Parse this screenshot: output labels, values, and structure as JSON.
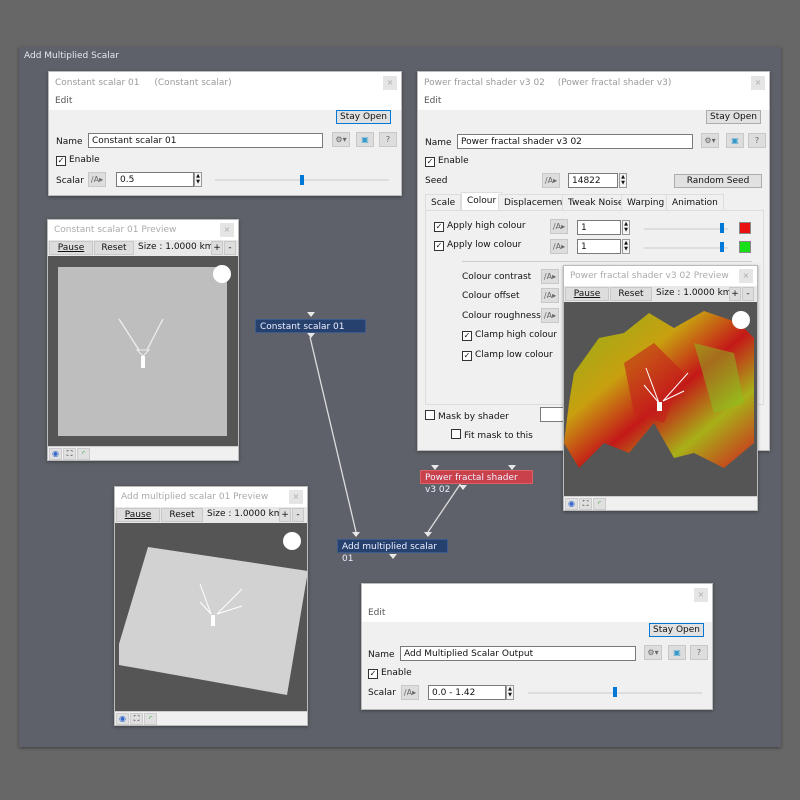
{
  "canvas": {
    "title": "Add Multiplied Scalar"
  },
  "constant_window": {
    "title": "Constant scalar 01",
    "type": "(Constant scalar)",
    "menu": "Edit",
    "close": "×",
    "stay_open": "Stay Open",
    "name_label": "Name",
    "name_value": "Constant scalar 01",
    "enable_label": "Enable",
    "enable_checked": true,
    "scalar_label": "Scalar",
    "scalar_value": "0.5",
    "slider_fraction": 0.5
  },
  "shader_window": {
    "title": "Power fractal shader v3 02",
    "type": "(Power fractal shader v3)",
    "menu": "Edit",
    "close": "×",
    "stay_open": "Stay Open",
    "name_label": "Name",
    "name_value": "Power fractal shader v3 02",
    "enable_label": "Enable",
    "seed_label": "Seed",
    "seed_value": "14822",
    "random_seed": "Random Seed",
    "tabs": [
      "Scale",
      "Colour",
      "Displacement",
      "Tweak Noise",
      "Warping",
      "Animation"
    ],
    "active_tab": "Colour",
    "apply_high_label": "Apply high colour",
    "apply_high_value": "1",
    "high_colour": "#e81010",
    "apply_low_label": "Apply low colour",
    "apply_low_value": "1",
    "low_colour": "#18e018",
    "colour_contrast": "Colour contrast",
    "colour_offset": "Colour offset",
    "colour_roughness": "Colour roughness",
    "clamp_high": "Clamp high colour",
    "clamp_low": "Clamp low colour",
    "mask_by_shader": "Mask by shader",
    "fit_mask": "Fit mask to this"
  },
  "previews": {
    "constant": {
      "title": "Constant scalar 01 Preview",
      "pause": "Pause",
      "reset": "Reset",
      "size": "Size : 1.0000 km",
      "plus": "+",
      "minus": "-"
    },
    "shader": {
      "title": "Power fractal shader v3 02 Preview",
      "pause": "Pause",
      "reset": "Reset",
      "size": "Size : 1.0000 km",
      "plus": "+",
      "minus": "-"
    },
    "multiplied": {
      "title": "Add multiplied scalar 01 Preview",
      "pause": "Pause",
      "reset": "Reset",
      "size": "Size : 1.0000 km",
      "plus": "+",
      "minus": "-"
    }
  },
  "nodes": {
    "constant": "Constant scalar 01",
    "shader": "Power fractal shader v3 02",
    "add": "Add multiplied scalar 01"
  },
  "output_window": {
    "menu": "Edit",
    "close": "×",
    "stay_open": "Stay Open",
    "name_label": "Name",
    "name_value": "Add Multiplied Scalar Output",
    "enable_label": "Enable",
    "scalar_label": "Scalar",
    "scalar_value": "0.0 - 1.42",
    "slider_fraction": 0.5
  },
  "icons": {
    "gear": "⚙▾",
    "preview": "▣",
    "help": "?",
    "func": "∕A▸",
    "check": "✓",
    "eye": "◉",
    "frame": "⛶",
    "curve": "◜"
  }
}
